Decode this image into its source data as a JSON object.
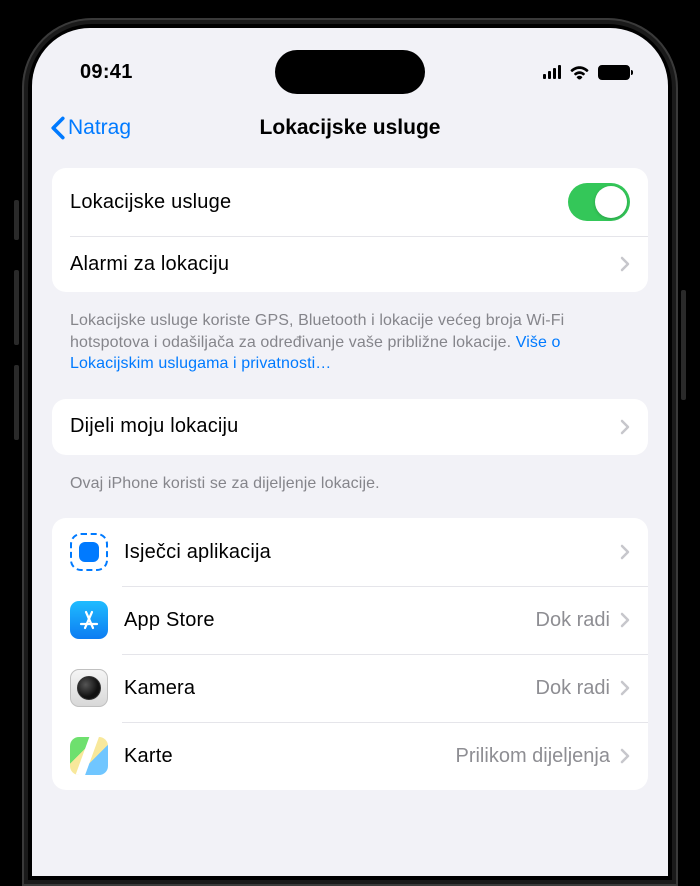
{
  "status": {
    "time": "09:41"
  },
  "nav": {
    "back": "Natrag",
    "title": "Lokacijske usluge"
  },
  "group1": {
    "location_services": "Lokacijske usluge",
    "location_alerts": "Alarmi za lokaciju"
  },
  "footer1": {
    "text": "Lokacijske usluge koriste GPS, Bluetooth i lokacije većeg broja Wi-Fi hotspotova i odašiljača za određivanje vaše približne lokacije. ",
    "link": "Više o Lokacijskim uslugama i privatnosti…"
  },
  "group2": {
    "share_location": "Dijeli moju lokaciju"
  },
  "footer2": {
    "text": "Ovaj iPhone koristi se za dijeljenje lokacije."
  },
  "apps": [
    {
      "name": "Isječci aplikacija",
      "value": ""
    },
    {
      "name": "App Store",
      "value": "Dok radi"
    },
    {
      "name": "Kamera",
      "value": "Dok radi"
    },
    {
      "name": "Karte",
      "value": "Prilikom dijeljenja"
    }
  ]
}
